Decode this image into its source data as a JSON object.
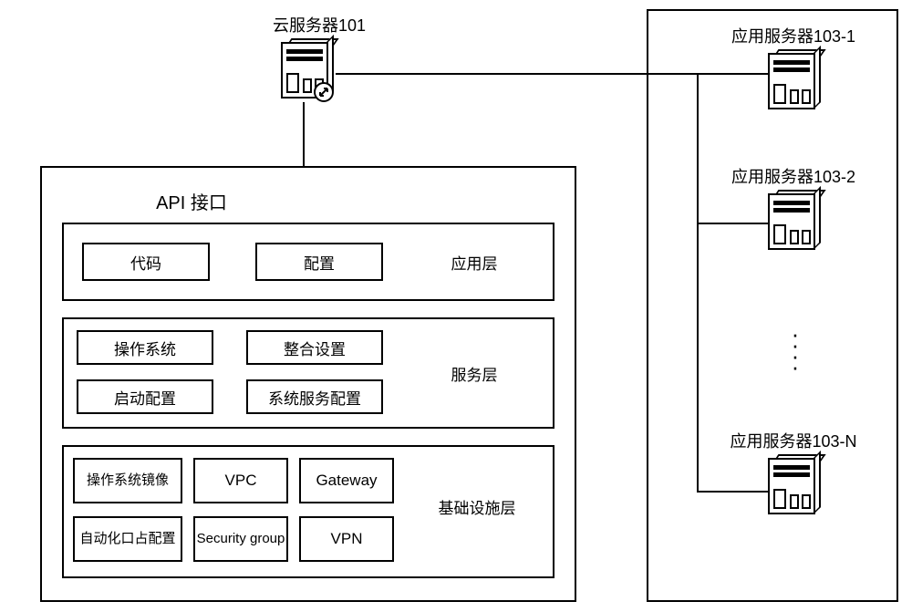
{
  "cloud_server": {
    "label": "云服务器101"
  },
  "app_servers": {
    "s1": "应用服务器103-1",
    "s2": "应用服务器103-2",
    "sn": "应用服务器103-N"
  },
  "api_box": {
    "title": "API 接口",
    "app_layer": {
      "label": "应用层",
      "code": "代码",
      "config": "配置"
    },
    "service_layer": {
      "label": "服务层",
      "os": "操作系统",
      "integration": "整合设置",
      "boot": "启动配置",
      "sys_service": "系统服务配置"
    },
    "infra_layer": {
      "label": "基础设施层",
      "os_image": "操作系统镜像",
      "vpc": "VPC",
      "gateway": "Gateway",
      "auto": "自动化口占配置",
      "secgroup": "Security group",
      "vpn": "VPN"
    }
  }
}
